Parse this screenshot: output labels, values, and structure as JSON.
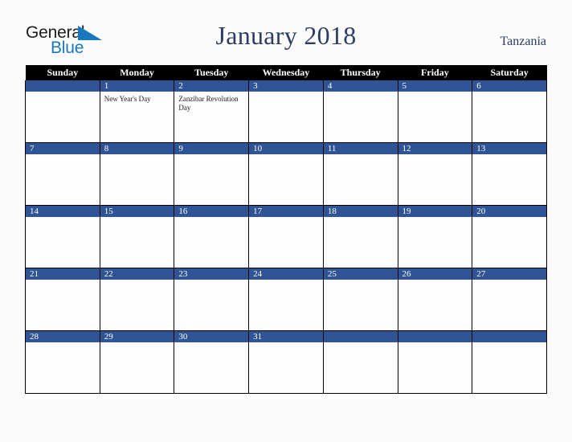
{
  "brand": {
    "name_part1": "General",
    "name_part2": "Blue",
    "triangle_icon": "triangle-icon",
    "accent_color": "#1878bd"
  },
  "header": {
    "title": "January 2018",
    "country": "Tanzania"
  },
  "colors": {
    "page_background": "#fbfbfb",
    "weekday_header_bg": "#000000",
    "weekday_header_text": "#ffffff",
    "daynum_bar_bg": "#2e5496",
    "daynum_text": "#ffffff",
    "title_text": "#2b3d63",
    "grid_border": "#000000",
    "cell_background": "#fdfdfd"
  },
  "calendar": {
    "month": "January",
    "year": "2018",
    "weekday_headers": [
      "Sunday",
      "Monday",
      "Tuesday",
      "Wednesday",
      "Thursday",
      "Friday",
      "Saturday"
    ],
    "weeks": [
      [
        {
          "day": "",
          "events": []
        },
        {
          "day": "1",
          "events": [
            "New Year's Day"
          ]
        },
        {
          "day": "2",
          "events": [
            "Zanzibar Revolution Day"
          ]
        },
        {
          "day": "3",
          "events": []
        },
        {
          "day": "4",
          "events": []
        },
        {
          "day": "5",
          "events": []
        },
        {
          "day": "6",
          "events": []
        }
      ],
      [
        {
          "day": "7",
          "events": []
        },
        {
          "day": "8",
          "events": []
        },
        {
          "day": "9",
          "events": []
        },
        {
          "day": "10",
          "events": []
        },
        {
          "day": "11",
          "events": []
        },
        {
          "day": "12",
          "events": []
        },
        {
          "day": "13",
          "events": []
        }
      ],
      [
        {
          "day": "14",
          "events": []
        },
        {
          "day": "15",
          "events": []
        },
        {
          "day": "16",
          "events": []
        },
        {
          "day": "17",
          "events": []
        },
        {
          "day": "18",
          "events": []
        },
        {
          "day": "19",
          "events": []
        },
        {
          "day": "20",
          "events": []
        }
      ],
      [
        {
          "day": "21",
          "events": []
        },
        {
          "day": "22",
          "events": []
        },
        {
          "day": "23",
          "events": []
        },
        {
          "day": "24",
          "events": []
        },
        {
          "day": "25",
          "events": []
        },
        {
          "day": "26",
          "events": []
        },
        {
          "day": "27",
          "events": []
        }
      ],
      [
        {
          "day": "28",
          "events": []
        },
        {
          "day": "29",
          "events": []
        },
        {
          "day": "30",
          "events": []
        },
        {
          "day": "31",
          "events": []
        },
        {
          "day": "",
          "events": []
        },
        {
          "day": "",
          "events": []
        },
        {
          "day": "",
          "events": []
        }
      ]
    ]
  }
}
